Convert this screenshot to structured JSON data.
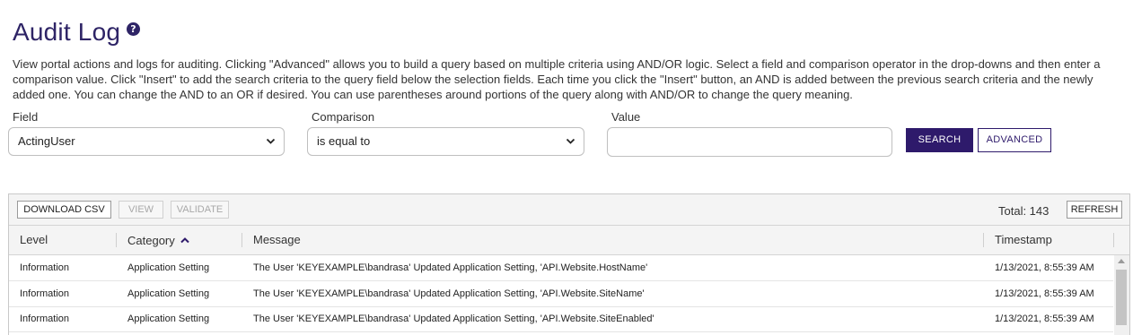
{
  "page": {
    "title": "Audit Log",
    "help_icon": "?",
    "description": "View portal actions and logs for auditing. Clicking \"Advanced\" allows you to build a query based on multiple criteria using AND/OR logic. Select a field and comparison operator in the drop-downs and then enter a comparison value. Click \"Insert\" to add the search criteria to the query field below the selection fields. Each time you click the \"Insert\" button, an AND is added between the previous search criteria and the newly added one. You can change the AND to an OR if desired. You can use parentheses around portions of the query along with AND/OR to change the query meaning."
  },
  "filters": {
    "field_label": "Field",
    "field_value": "ActingUser",
    "comparison_label": "Comparison",
    "comparison_value": "is equal to",
    "value_label": "Value",
    "value_input": "",
    "search_button": "SEARCH",
    "advanced_button": "ADVANCED"
  },
  "toolbar": {
    "download_csv": "DOWNLOAD CSV",
    "view": "VIEW",
    "validate": "VALIDATE",
    "total": "Total: 143",
    "refresh": "REFRESH"
  },
  "table": {
    "columns": {
      "level": "Level",
      "category": "Category",
      "category_sort": "^",
      "message": "Message",
      "timestamp": "Timestamp"
    },
    "rows": [
      {
        "level": "Information",
        "category": "Application Setting",
        "message": "The User 'KEYEXAMPLE\\bandrasa' Updated Application Setting, 'API.Website.HostName'",
        "timestamp": "1/13/2021, 8:55:39 AM"
      },
      {
        "level": "Information",
        "category": "Application Setting",
        "message": "The User 'KEYEXAMPLE\\bandrasa' Updated Application Setting, 'API.Website.SiteName'",
        "timestamp": "1/13/2021, 8:55:39 AM"
      },
      {
        "level": "Information",
        "category": "Application Setting",
        "message": "The User 'KEYEXAMPLE\\bandrasa' Updated Application Setting, 'API.Website.SiteEnabled'",
        "timestamp": "1/13/2021, 8:55:39 AM"
      }
    ]
  },
  "icons": {
    "chevron": "chevron-down-icon",
    "sort": "sort-ascending-icon",
    "scroll_up": "scroll-up-arrow-icon"
  },
  "colors": {
    "brand": "#2e1a6b",
    "title": "#2e2466"
  }
}
